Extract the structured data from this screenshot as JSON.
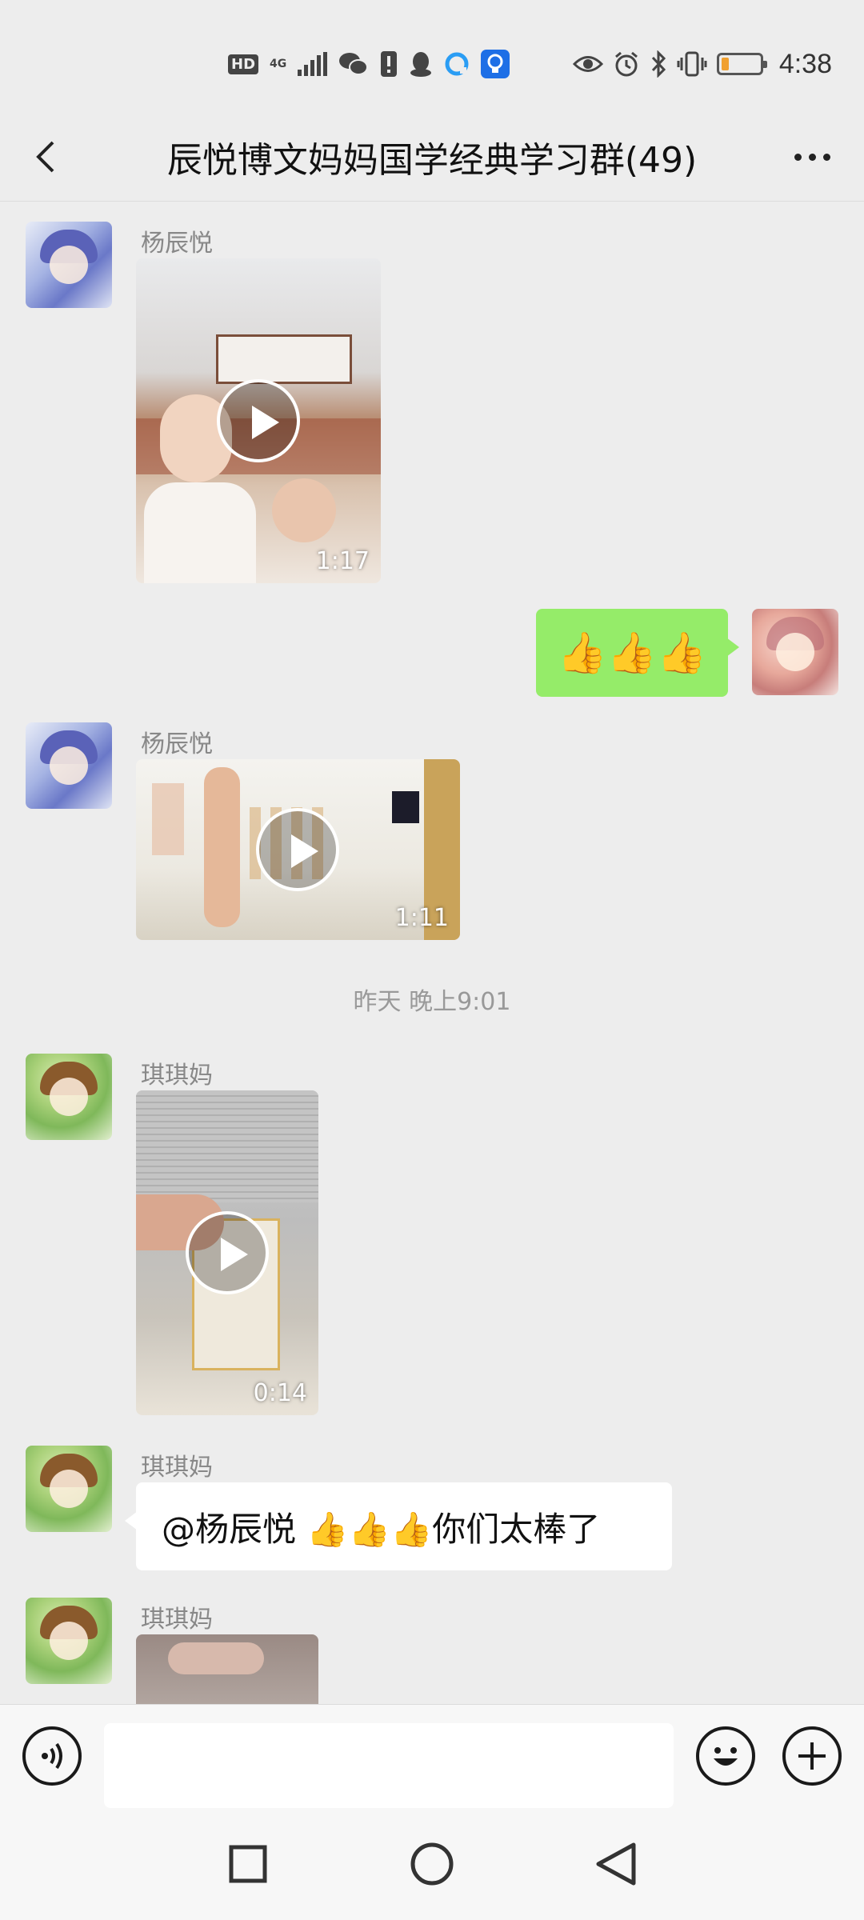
{
  "status_bar": {
    "hd_label": "HD",
    "network_label": "4G",
    "time": "4:38",
    "battery_level": 0.2,
    "icons": [
      "hd-icon",
      "4g-icon",
      "signal-icon",
      "wechat-icon",
      "alert-icon",
      "qq-icon",
      "browser-icon",
      "bulb-app-icon",
      "eye-icon",
      "alarm-icon",
      "bluetooth-icon",
      "vibrate-icon",
      "battery-icon"
    ]
  },
  "header": {
    "title": "辰悦博文妈妈国学经典学习群(49)",
    "back_icon": "chevron-left-icon",
    "more_icon": "more-dots-icon"
  },
  "messages": [
    {
      "type": "video",
      "side": "left",
      "sender": "杨辰悦",
      "duration": "1:17"
    },
    {
      "type": "text",
      "side": "right",
      "text": "👍👍👍"
    },
    {
      "type": "video",
      "side": "left",
      "sender": "杨辰悦",
      "duration": "1:11"
    },
    {
      "type": "timestamp",
      "text": "昨天 晚上9:01"
    },
    {
      "type": "video",
      "side": "left",
      "sender": "琪琪妈",
      "duration": "0:14"
    },
    {
      "type": "text",
      "side": "left",
      "sender": "琪琪妈",
      "text": "@杨辰悦 👍👍👍你们太棒了"
    },
    {
      "type": "video",
      "side": "left",
      "sender": "琪琪妈",
      "duration": ""
    }
  ],
  "input_bar": {
    "value": "",
    "voice_icon": "voice-icon",
    "emoji_icon": "emoji-icon",
    "plus_icon": "plus-icon"
  },
  "nav_bar": {
    "icons": [
      "recents-icon",
      "home-icon",
      "back-icon"
    ]
  },
  "colors": {
    "background": "#ededed",
    "self_bubble": "#95ec69",
    "other_bubble": "#ffffff",
    "sender_name": "#888888"
  }
}
